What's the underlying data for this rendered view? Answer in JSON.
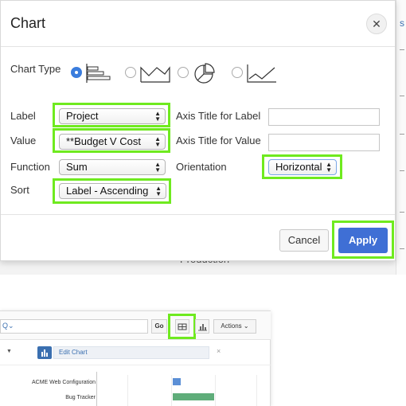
{
  "dialog": {
    "title": "Chart",
    "chart_type_label": "Chart Type",
    "chart_types": [
      {
        "name": "horizontal-bar",
        "selected": true
      },
      {
        "name": "area",
        "selected": false
      },
      {
        "name": "pie",
        "selected": false
      },
      {
        "name": "line",
        "selected": false
      }
    ],
    "fields": {
      "label": {
        "label": "Label",
        "value": "Project"
      },
      "value": {
        "label": "Value",
        "value": "**Budget V Cost"
      },
      "function": {
        "label": "Function",
        "value": "Sum"
      },
      "sort": {
        "label": "Sort",
        "value": "Label - Ascending"
      },
      "axis_title_label": {
        "label": "Axis Title for Label",
        "value": ""
      },
      "axis_title_value": {
        "label": "Axis Title for Value",
        "value": ""
      },
      "orientation": {
        "label": "Orientation",
        "value": "Horizontal"
      }
    },
    "cancel_label": "Cancel",
    "apply_label": "Apply"
  },
  "background": {
    "letter": "s",
    "partial_text": "Production"
  },
  "report": {
    "go_label": "Go",
    "actions_label": "Actions",
    "edit_chart_label": "Edit Chart",
    "remove_symbol": "×",
    "rows": [
      {
        "label": "ACME Web Configuration"
      },
      {
        "label": "Bug Tracker"
      }
    ]
  },
  "colors": {
    "highlight": "#6fea1f",
    "apply_button": "#3f6fd5",
    "bar_blue": "#5b8fd6",
    "bar_green": "#5fad7a",
    "link": "#3a6fb0"
  }
}
